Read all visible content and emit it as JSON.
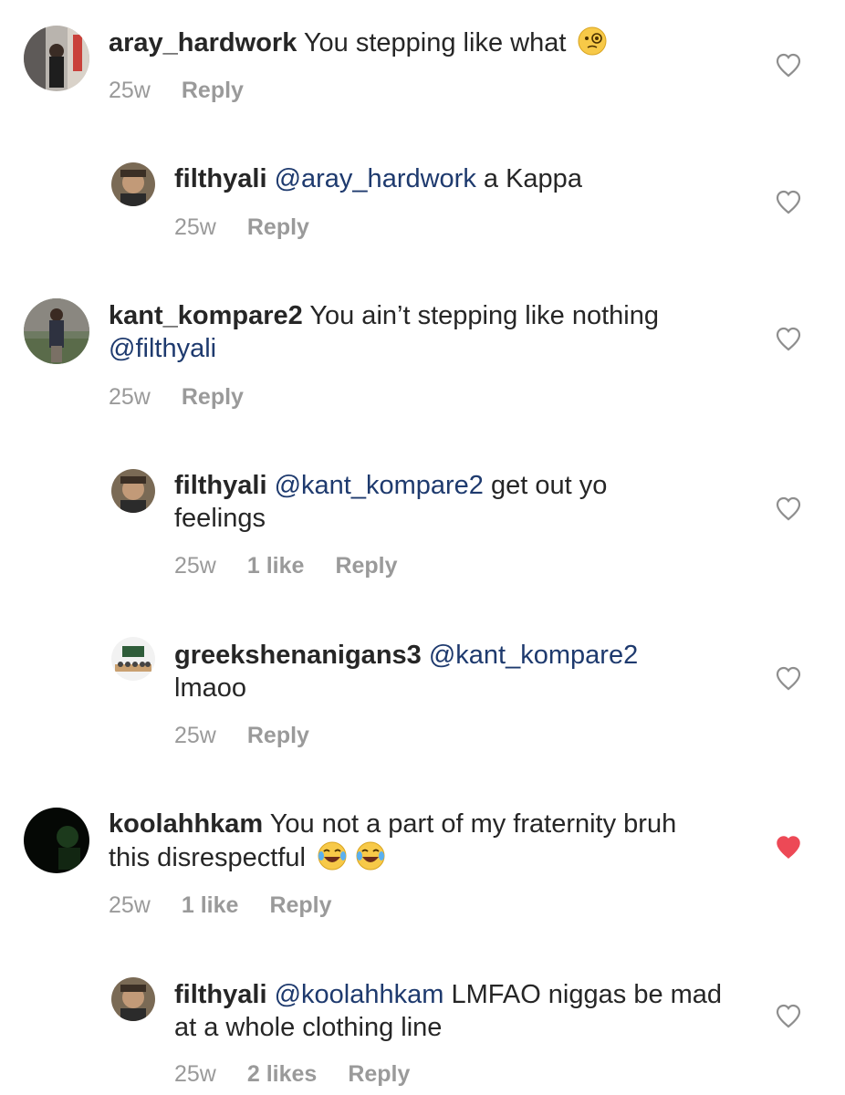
{
  "comments": [
    {
      "username": "aray_hardwork",
      "body": " You stepping like what",
      "emoji": "monocle-emoji",
      "time": "25w",
      "reply_label": "Reply",
      "liked": false
    },
    {
      "username": "filthyali",
      "mention": "@aray_hardwork",
      "body": " a Kappa",
      "time": "25w",
      "reply_label": "Reply",
      "liked": false
    },
    {
      "username": "kant_kompare2",
      "body": " You ain’t stepping like nothing ",
      "mention_end": "@filthyali",
      "time": "25w",
      "reply_label": "Reply",
      "liked": false
    },
    {
      "username": "filthyali",
      "mention": "@kant_kompare2",
      "body": " get out yo feelings",
      "time": "25w",
      "likes": "1 like",
      "reply_label": "Reply",
      "liked": false
    },
    {
      "username": "greekshenanigans3",
      "mention": "@kant_kompare2",
      "body": " lmaoo",
      "time": "25w",
      "reply_label": "Reply",
      "liked": false
    },
    {
      "username": "koolahhkam",
      "body": " You not a part of my fraternity bruh this disrespectful",
      "emoji": "tears-of-joy-emoji-x2",
      "time": "25w",
      "likes": "1 like",
      "reply_label": "Reply",
      "liked": true
    },
    {
      "username": "filthyali",
      "mention": "@koolahhkam",
      "body": " LMFAO niggas be mad at a whole clothing line",
      "time": "25w",
      "likes": "2 likes",
      "reply_label": "Reply",
      "liked": false
    }
  ],
  "colors": {
    "text": "#262626",
    "mention": "#1e3a6e",
    "meta": "#9a9a9a",
    "heart_outline": "#8e8e8e",
    "heart_liked": "#ed4956"
  },
  "icons": {
    "like": "heart-icon",
    "liked": "heart-filled-icon"
  }
}
